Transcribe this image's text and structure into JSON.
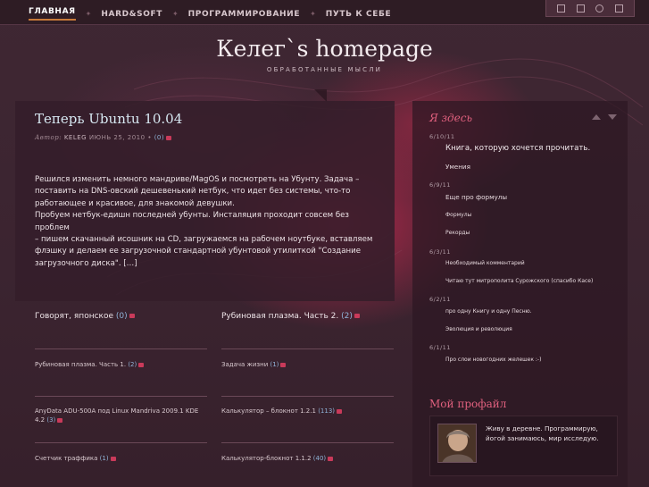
{
  "nav": {
    "items": [
      {
        "label": "ГЛАВНАЯ",
        "active": true
      },
      {
        "label": "HARD&SOFT",
        "active": false
      },
      {
        "label": "ПРОГРАММИРОВАНИЕ",
        "active": false
      },
      {
        "label": "ПУТЬ К СЕБЕ",
        "active": false
      }
    ],
    "separator": "✦"
  },
  "toolbar": {
    "icons": [
      "rss-icon",
      "resize-icon",
      "search-icon",
      "search-field-icon"
    ]
  },
  "header": {
    "title": "Келег`s homepage",
    "subtitle": "ОБРАБОТАННЫЕ МЫСЛИ"
  },
  "post": {
    "title": "Теперь Ubuntu 10.04",
    "author_label": "Автор:",
    "author": "KELEG",
    "date": "ИЮНЬ 25, 2010",
    "bullet": "•",
    "comments": "(0)",
    "body_lines": [
      "Решился изменить немного мандриве/MagOS и посмотреть на Убунту. Задача –",
      "поставить на DNS-овский дешевенький нетбук, что идет без системы, что-то",
      "работающее и красивое, для знакомой девушки.",
      "Пробуем нетбук-едишн последней убунты. Инсталяция проходит совсем без проблем",
      "– пишем скачанный исошник на CD, загружаемся на рабочем ноутбуке, вставляем",
      "флэшку и делаем ее загрузочной стандартной убунтовой утилиткой \"Создание",
      "загрузочного диска\". […]"
    ]
  },
  "grid": [
    {
      "title": "Говорят, японское",
      "count": "(0)"
    },
    {
      "title": "Рубиновая плазма. Часть 2.",
      "count": "(2)"
    },
    {
      "title": "Рубиновая плазма. Часть 1.",
      "count": "(2)"
    },
    {
      "title": "Задача жизни",
      "count": "(1)"
    },
    {
      "title": "AnyData ADU-500A под Linux Mandriva 2009.1 KDE 4.2",
      "count": "(3)"
    },
    {
      "title": "Калькулятор – блокнот 1.2.1",
      "count": "(113)"
    },
    {
      "title": "Счетчик траффика",
      "count": "(1)"
    },
    {
      "title": "Калькулятор-блокнот 1.1.2",
      "count": "(40)"
    }
  ],
  "sidebar": {
    "here_title": "Я здесь",
    "groups": [
      {
        "date": "6/10/11",
        "links": [
          "Книга, которую хочется прочитать.",
          "Умения"
        ]
      },
      {
        "date": "6/9/11",
        "links": [
          "Еще про формулы",
          "Формулы",
          "Рекорды"
        ]
      },
      {
        "date": "6/3/11",
        "links": [
          "Необходимый комментарий",
          "Читаю тут митрополита Сурожского (спасибо Касе)"
        ]
      },
      {
        "date": "6/2/11",
        "links": [
          "про одну Книгу и одну Песню.",
          "Эволюция и революция"
        ]
      },
      {
        "date": "6/1/11",
        "links": [
          "Про слои новогодних желешек :-)"
        ]
      }
    ],
    "profile_title": "Мой профайл",
    "profile_text": "Живу в деревне. Программирую, йогой занимаюсь, мир исследую."
  },
  "colors": {
    "accent": "#e0607e",
    "link_count": "#8fb3d8",
    "background": "#3a2530"
  }
}
